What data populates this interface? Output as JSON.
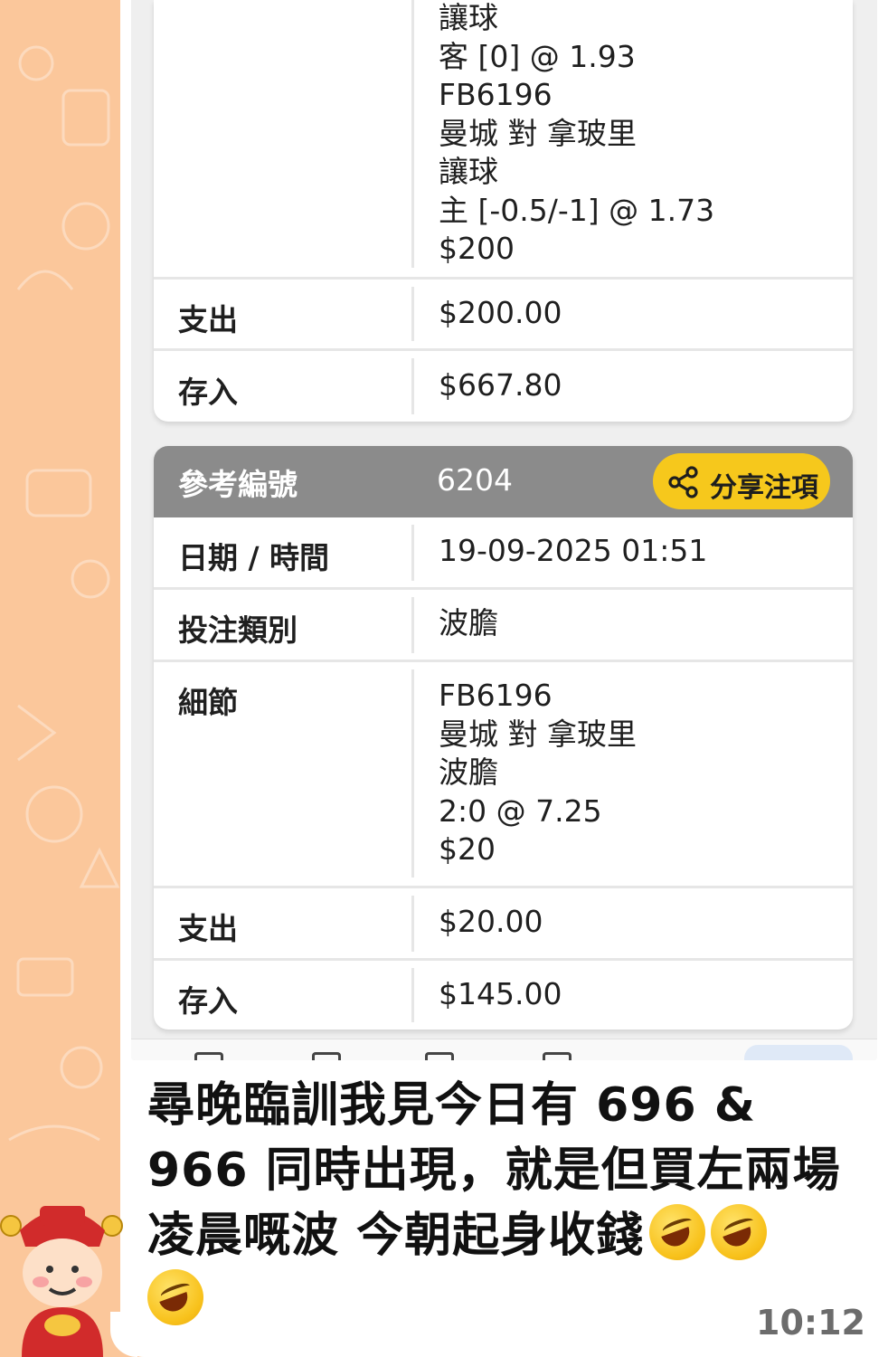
{
  "top_card": {
    "detail_lines": "讓球\n客 [0] @ 1.93\nFB6196\n曼城 對 拿玻里\n讓球\n主 [-0.5/-1] @ 1.73\n$200",
    "expense_label": "支出",
    "expense_value": "$200.00",
    "deposit_label": "存入",
    "deposit_value": "$667.80"
  },
  "bottom_card": {
    "ref_label": "參考編號",
    "ref_value": "6204",
    "share_label": "分享注項",
    "datetime_label": "日期 / 時間",
    "datetime_value": "19-09-2025 01:51",
    "bet_type_label": "投注類別",
    "bet_type_value": "波膽",
    "details_label": "細節",
    "details_value": "FB6196\n曼城 對 拿玻里\n波膽\n2:0 @ 7.25\n$20",
    "expense_label": "支出",
    "expense_value": "$20.00",
    "deposit_label": "存入",
    "deposit_value": "$145.00"
  },
  "message": {
    "text": "尋晚臨訓我見今日有 696 & 966 同時出現，就是但買左兩場凌晨嘅波 今朝起身收錢",
    "emoji": "rolling-on-floor-laughing",
    "time": "10:12"
  },
  "colors": {
    "wallpaper": "#fbc79b",
    "header_gray": "#8b8b8b",
    "share_yellow": "#f6c81c"
  }
}
